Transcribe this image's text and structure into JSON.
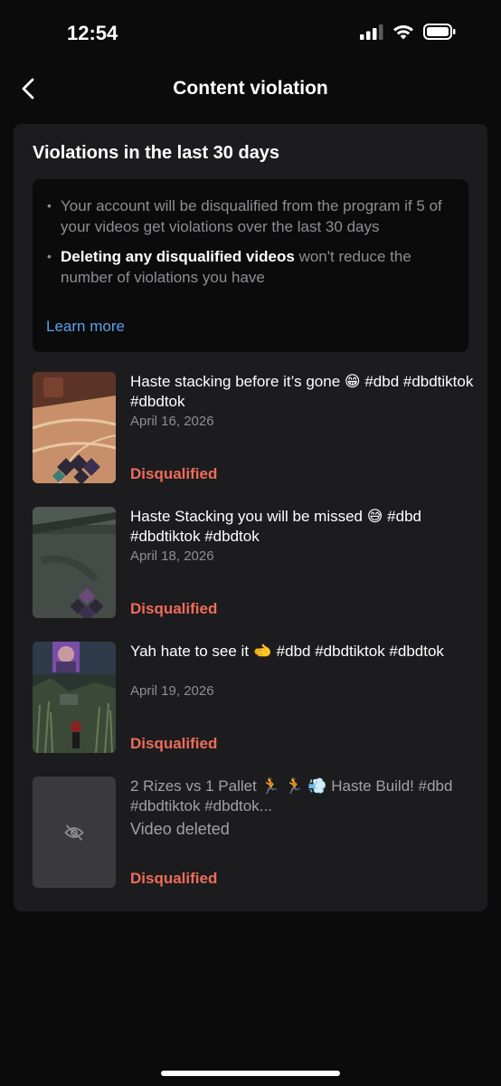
{
  "status_bar": {
    "time": "12:54"
  },
  "nav": {
    "title": "Content violation",
    "back_icon": "chevron-left-icon"
  },
  "card": {
    "title": "Violations in the last 30 days",
    "bullets": [
      {
        "bold": "",
        "text": "Your account will be disqualified from the program if 5 of your videos get violations over the last 30 days"
      },
      {
        "bold": "Deleting any disqualified videos",
        "text": " won't reduce the number of violations you have"
      }
    ],
    "learn_more": "Learn more"
  },
  "videos": [
    {
      "title": "Haste stacking before it’s gone 😁 #dbd #dbdtiktok #dbdtok",
      "date": "April 16, 2026",
      "status": "Disqualified"
    },
    {
      "title": "Haste Stacking you will be missed 😅 #dbd #dbdtiktok #dbdtok",
      "date": "April 18, 2026",
      "status": "Disqualified"
    },
    {
      "title": "Yah hate to see it 🫲 #dbd #dbdtiktok #dbdtok",
      "date": "April 19, 2026",
      "status": "Disqualified"
    },
    {
      "title": "2 Rizes vs 1 Pallet 🏃 🏃 💨 Haste Build! #dbd #dbdtiktok #dbdtok...",
      "date": "",
      "deleted_label": "Video deleted",
      "status": "Disqualified"
    }
  ],
  "colors": {
    "background": "#0b0b0b",
    "card": "#1c1c1e",
    "link": "#5aa0ef",
    "disqualified": "#ee6c5a"
  },
  "icons": {
    "signal": "cellular-signal-icon",
    "wifi": "wifi-icon",
    "battery": "battery-icon",
    "hidden": "eye-slash-icon"
  }
}
